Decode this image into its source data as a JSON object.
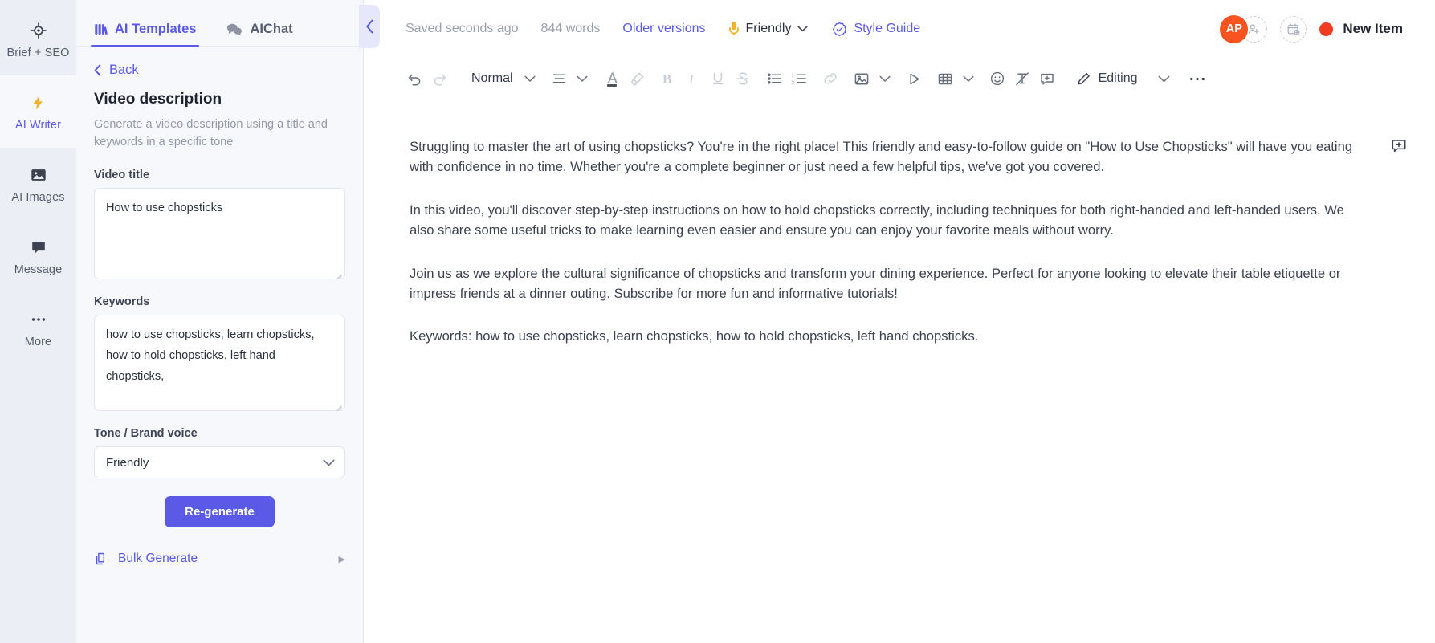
{
  "rail": {
    "items": [
      {
        "label": "Brief + SEO",
        "icon": "target-icon",
        "active": false
      },
      {
        "label": "AI Writer",
        "icon": "lightning-bolt-icon",
        "active": true
      },
      {
        "label": "AI Images",
        "icon": "image-icon",
        "active": false
      },
      {
        "label": "Message",
        "icon": "chat-bubble-icon",
        "active": false
      },
      {
        "label": "More",
        "icon": "ellipsis-icon",
        "active": false
      }
    ]
  },
  "panel": {
    "tabs": [
      {
        "label": "AI Templates",
        "icon": "templates-grid-icon",
        "active": true
      },
      {
        "label": "AIChat",
        "icon": "chat-bubbles-icon",
        "active": false
      }
    ],
    "back_label": "Back",
    "template_title": "Video description",
    "template_subtitle": "Generate a video description using a title and keywords in a specific tone",
    "fields": {
      "video_title": {
        "label": "Video title",
        "value": "How to use chopsticks",
        "placeholder": "Video title"
      },
      "keywords": {
        "label": "Keywords",
        "value": "how to use chopsticks, learn chopsticks, how to hold chopsticks, left hand chopsticks,",
        "placeholder": "Keywords"
      },
      "tone": {
        "label": "Tone / Brand voice",
        "value": "Friendly"
      }
    },
    "regenerate_label": "Re-generate",
    "bulk_generate_label": "Bulk Generate",
    "collapse_icon": "chevron-left-icon"
  },
  "topbar": {
    "saved_status": "Saved seconds ago",
    "word_count": "844 words",
    "older_versions": "Older versions",
    "tone_label": "Friendly",
    "tone_icon": "microphone-icon",
    "style_guide": "Style Guide",
    "style_guide_icon": "check-badge-icon",
    "avatar_initials": "AP",
    "add_user_icon": "add-user-icon",
    "add_task_icon": "add-calendar-icon",
    "new_item_label": "New Item",
    "new_item_dot_color": "#f03c20",
    "avatar_color": "#f9531f"
  },
  "toolbar": {
    "undo_icon": "undo-icon",
    "redo_icon": "redo-icon",
    "paragraph_style": "Normal",
    "align_icon": "align-icon",
    "text_color_icon": "text-color-icon",
    "highlight_icon": "highlighter-icon",
    "bold_icon": "bold-icon",
    "italic_icon": "italic-icon",
    "underline_icon": "underline-icon",
    "strikethrough_icon": "strikethrough-icon",
    "bullet_list_icon": "bullet-list-icon",
    "numbered_list_icon": "numbered-list-icon",
    "link_icon": "link-icon",
    "image_icon": "image-icon",
    "video_icon": "play-triangle-icon",
    "table_icon": "table-icon",
    "emoji_icon": "emoji-icon",
    "clear-format_icon": "clear-format-icon",
    "add_comment_icon": "add-comment-icon",
    "mode_icon": "pencil-icon",
    "mode_label": "Editing",
    "more_icon": "ellipsis-icon"
  },
  "document": {
    "comment_icon": "add-comment-icon",
    "paragraphs": [
      "Struggling to master the art of using chopsticks? You're in the right place! This friendly and easy-to-follow guide on \"How to Use Chopsticks\" will have you eating with confidence in no time. Whether you're a complete beginner or just need a few helpful tips, we've got you covered.",
      "In this video, you'll discover step-by-step instructions on how to hold chopsticks correctly, including techniques for both right-handed and left-handed users. We also share some useful tricks to make learning even easier and ensure you can enjoy your favorite meals without worry.",
      "Join us as we explore the cultural significance of chopsticks and transform your dining experience. Perfect for anyone looking to elevate their table etiquette or impress friends at a dinner outing. Subscribe for more fun and informative tutorials!",
      "Keywords: how to use chopsticks, learn chopsticks, how to hold chopsticks, left hand chopsticks."
    ]
  }
}
